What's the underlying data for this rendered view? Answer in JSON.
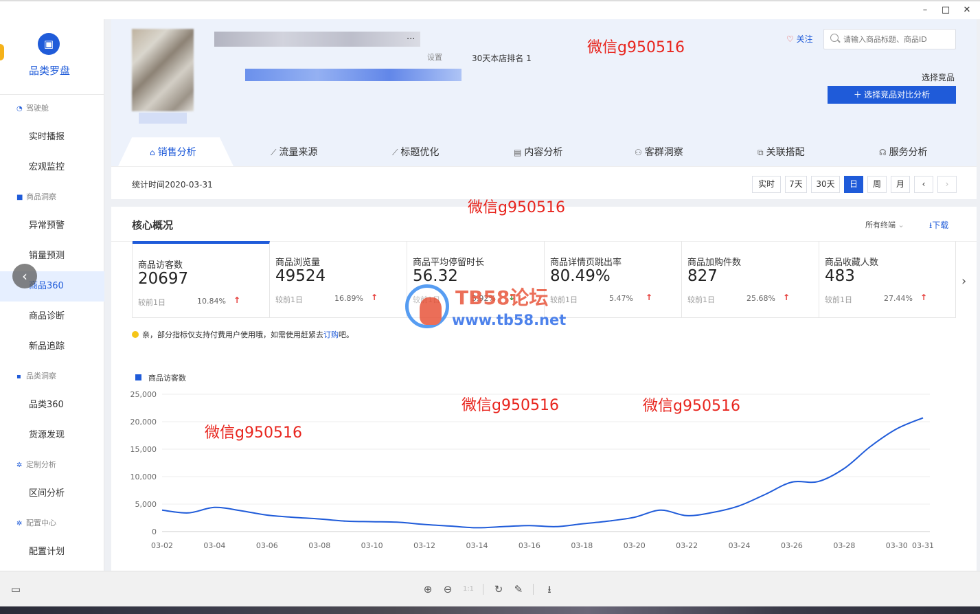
{
  "window": {
    "minimize": "–",
    "maximize": "□",
    "close": "✕"
  },
  "sidebar": {
    "logo_icon": "shopping-bag-icon",
    "logo_text": "品类罗盘",
    "groups": [
      {
        "label": "驾驶舱",
        "icon": "dashboard-icon"
      },
      {
        "label": "商品洞察",
        "icon": "lock-icon"
      },
      {
        "label": "品类洞察",
        "icon": "grid-icon"
      },
      {
        "label": "定制分析",
        "icon": "gear-icon"
      },
      {
        "label": "配置中心",
        "icon": "gear-icon"
      }
    ],
    "items": [
      "实时播报",
      "宏观监控",
      "异常预警",
      "销量预测",
      "商品360",
      "商品诊断",
      "新品追踪",
      "品类360",
      "货源发现",
      "区间分析",
      "配置计划"
    ],
    "active_item": "商品360"
  },
  "header": {
    "title_tail": "...",
    "setting": "设置",
    "rank": "30天本店排名 1",
    "follow_label": "关注",
    "search_placeholder": "请输入商品标题、商品ID",
    "choose_label": "选择竞品",
    "compare_button": "选择竞品对比分析",
    "sub_tail": "前"
  },
  "tabs": [
    {
      "label": "销售分析",
      "icon": "bag-icon",
      "active": true
    },
    {
      "label": "流量来源",
      "icon": "trend-icon"
    },
    {
      "label": "标题优化",
      "icon": "trend-icon"
    },
    {
      "label": "内容分析",
      "icon": "document-icon"
    },
    {
      "label": "客群洞察",
      "icon": "users-icon"
    },
    {
      "label": "关联搭配",
      "icon": "link-icon"
    },
    {
      "label": "服务分析",
      "icon": "headset-icon"
    }
  ],
  "time_bar": {
    "stat_time": "统计时间2020-03-31",
    "buttons": [
      "实时",
      "7天",
      "30天",
      "日",
      "周",
      "月"
    ],
    "active_button": "日",
    "prev": "‹",
    "next": "›"
  },
  "core": {
    "title": "核心概况",
    "terminal": "所有终端",
    "download": "下载",
    "metrics": [
      {
        "name": "商品访客数",
        "value": "20697",
        "compare": "较前1日",
        "pct": "10.84%",
        "dir": "up"
      },
      {
        "name": "商品浏览量",
        "value": "49524",
        "compare": "较前1日",
        "pct": "16.89%",
        "dir": "up"
      },
      {
        "name": "商品平均停留时长",
        "value": "56.32",
        "compare": "较前1日",
        "pct": "5.92%",
        "dir": "down"
      },
      {
        "name": "商品详情页跳出率",
        "value": "80.49%",
        "compare": "较前1日",
        "pct": "5.47%",
        "dir": "up"
      },
      {
        "name": "商品加购件数",
        "value": "827",
        "compare": "较前1日",
        "pct": "25.68%",
        "dir": "up"
      },
      {
        "name": "商品收藏人数",
        "value": "483",
        "compare": "较前1日",
        "pct": "27.44%",
        "dir": "up"
      }
    ],
    "notice_pre": "亲，部分指标仅支持付费用户使用哦，如需使用赶紧去",
    "notice_link": "订购",
    "notice_post": "吧。"
  },
  "watermarks": [
    "微信g950516",
    "微信g950516",
    "微信g950516",
    "微信g950516",
    "微信g950516"
  ],
  "tb58": {
    "name": "TB58论坛",
    "url": "www.tb58.net"
  },
  "colors": {
    "accent": "#1f5bd9",
    "up": "#e53935",
    "watermark": "#e8251e"
  },
  "chart_data": {
    "type": "line",
    "title": "",
    "xlabel": "",
    "ylabel": "",
    "legend": "top-left",
    "grid": true,
    "ylim": [
      0,
      25000
    ],
    "yticks": [
      "25,000",
      "20,000",
      "15,000",
      "10,000",
      "5,000",
      "0"
    ],
    "x": [
      "03-02",
      "03-03",
      "03-04",
      "03-05",
      "03-06",
      "03-07",
      "03-08",
      "03-09",
      "03-10",
      "03-11",
      "03-12",
      "03-13",
      "03-14",
      "03-15",
      "03-16",
      "03-17",
      "03-18",
      "03-19",
      "03-20",
      "03-21",
      "03-22",
      "03-23",
      "03-24",
      "03-25",
      "03-26",
      "03-27",
      "03-28",
      "03-29",
      "03-30",
      "03-31"
    ],
    "xticks": [
      "03-02",
      "03-04",
      "03-06",
      "03-08",
      "03-10",
      "03-12",
      "03-14",
      "03-16",
      "03-18",
      "03-20",
      "03-22",
      "03-24",
      "03-26",
      "03-28",
      "03-30",
      "03-31"
    ],
    "series": [
      {
        "name": "商品访客数",
        "values": [
          3900,
          3400,
          4400,
          3800,
          3000,
          2600,
          2300,
          1900,
          1800,
          1700,
          1300,
          1000,
          700,
          900,
          1100,
          900,
          1400,
          1900,
          2600,
          3900,
          2900,
          3500,
          4700,
          6800,
          9000,
          9100,
          11500,
          15500,
          18700,
          20700
        ]
      }
    ]
  }
}
